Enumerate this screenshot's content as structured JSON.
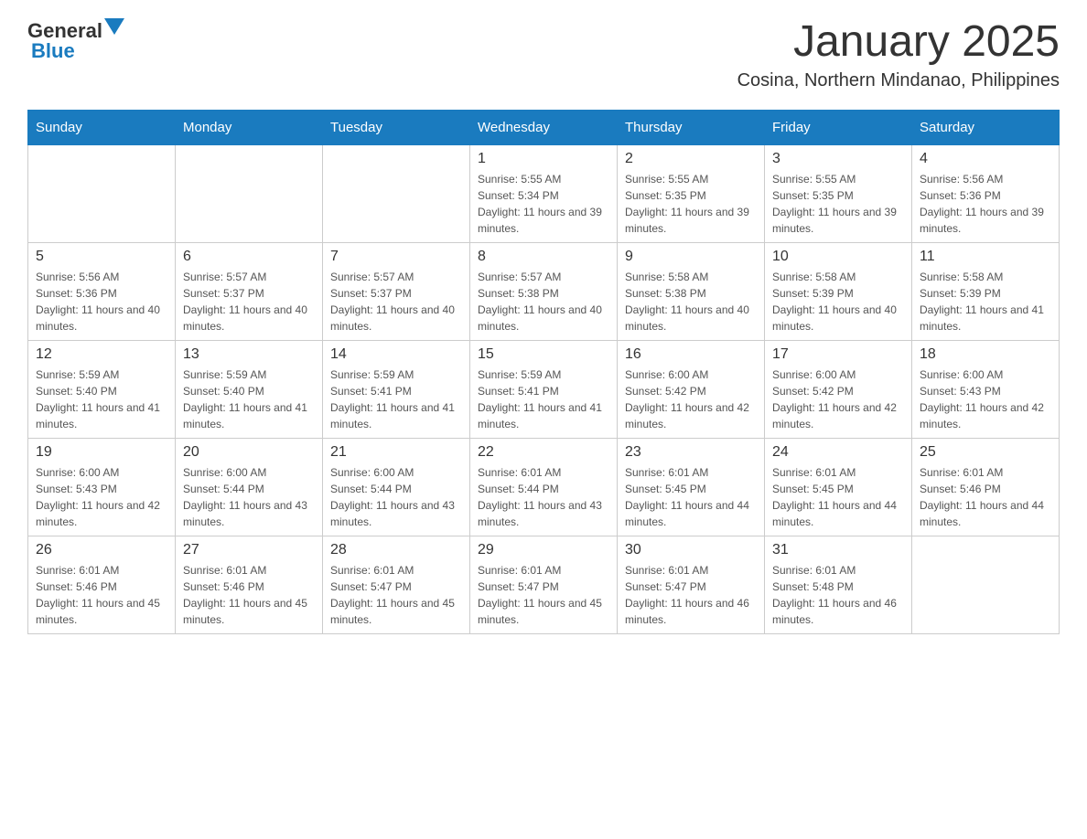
{
  "header": {
    "logo": {
      "general": "General",
      "blue": "Blue"
    },
    "title": "January 2025",
    "location": "Cosina, Northern Mindanao, Philippines"
  },
  "weekdays": [
    "Sunday",
    "Monday",
    "Tuesday",
    "Wednesday",
    "Thursday",
    "Friday",
    "Saturday"
  ],
  "weeks": [
    [
      {
        "day": "",
        "info": ""
      },
      {
        "day": "",
        "info": ""
      },
      {
        "day": "",
        "info": ""
      },
      {
        "day": "1",
        "info": "Sunrise: 5:55 AM\nSunset: 5:34 PM\nDaylight: 11 hours and 39 minutes."
      },
      {
        "day": "2",
        "info": "Sunrise: 5:55 AM\nSunset: 5:35 PM\nDaylight: 11 hours and 39 minutes."
      },
      {
        "day": "3",
        "info": "Sunrise: 5:55 AM\nSunset: 5:35 PM\nDaylight: 11 hours and 39 minutes."
      },
      {
        "day": "4",
        "info": "Sunrise: 5:56 AM\nSunset: 5:36 PM\nDaylight: 11 hours and 39 minutes."
      }
    ],
    [
      {
        "day": "5",
        "info": "Sunrise: 5:56 AM\nSunset: 5:36 PM\nDaylight: 11 hours and 40 minutes."
      },
      {
        "day": "6",
        "info": "Sunrise: 5:57 AM\nSunset: 5:37 PM\nDaylight: 11 hours and 40 minutes."
      },
      {
        "day": "7",
        "info": "Sunrise: 5:57 AM\nSunset: 5:37 PM\nDaylight: 11 hours and 40 minutes."
      },
      {
        "day": "8",
        "info": "Sunrise: 5:57 AM\nSunset: 5:38 PM\nDaylight: 11 hours and 40 minutes."
      },
      {
        "day": "9",
        "info": "Sunrise: 5:58 AM\nSunset: 5:38 PM\nDaylight: 11 hours and 40 minutes."
      },
      {
        "day": "10",
        "info": "Sunrise: 5:58 AM\nSunset: 5:39 PM\nDaylight: 11 hours and 40 minutes."
      },
      {
        "day": "11",
        "info": "Sunrise: 5:58 AM\nSunset: 5:39 PM\nDaylight: 11 hours and 41 minutes."
      }
    ],
    [
      {
        "day": "12",
        "info": "Sunrise: 5:59 AM\nSunset: 5:40 PM\nDaylight: 11 hours and 41 minutes."
      },
      {
        "day": "13",
        "info": "Sunrise: 5:59 AM\nSunset: 5:40 PM\nDaylight: 11 hours and 41 minutes."
      },
      {
        "day": "14",
        "info": "Sunrise: 5:59 AM\nSunset: 5:41 PM\nDaylight: 11 hours and 41 minutes."
      },
      {
        "day": "15",
        "info": "Sunrise: 5:59 AM\nSunset: 5:41 PM\nDaylight: 11 hours and 41 minutes."
      },
      {
        "day": "16",
        "info": "Sunrise: 6:00 AM\nSunset: 5:42 PM\nDaylight: 11 hours and 42 minutes."
      },
      {
        "day": "17",
        "info": "Sunrise: 6:00 AM\nSunset: 5:42 PM\nDaylight: 11 hours and 42 minutes."
      },
      {
        "day": "18",
        "info": "Sunrise: 6:00 AM\nSunset: 5:43 PM\nDaylight: 11 hours and 42 minutes."
      }
    ],
    [
      {
        "day": "19",
        "info": "Sunrise: 6:00 AM\nSunset: 5:43 PM\nDaylight: 11 hours and 42 minutes."
      },
      {
        "day": "20",
        "info": "Sunrise: 6:00 AM\nSunset: 5:44 PM\nDaylight: 11 hours and 43 minutes."
      },
      {
        "day": "21",
        "info": "Sunrise: 6:00 AM\nSunset: 5:44 PM\nDaylight: 11 hours and 43 minutes."
      },
      {
        "day": "22",
        "info": "Sunrise: 6:01 AM\nSunset: 5:44 PM\nDaylight: 11 hours and 43 minutes."
      },
      {
        "day": "23",
        "info": "Sunrise: 6:01 AM\nSunset: 5:45 PM\nDaylight: 11 hours and 44 minutes."
      },
      {
        "day": "24",
        "info": "Sunrise: 6:01 AM\nSunset: 5:45 PM\nDaylight: 11 hours and 44 minutes."
      },
      {
        "day": "25",
        "info": "Sunrise: 6:01 AM\nSunset: 5:46 PM\nDaylight: 11 hours and 44 minutes."
      }
    ],
    [
      {
        "day": "26",
        "info": "Sunrise: 6:01 AM\nSunset: 5:46 PM\nDaylight: 11 hours and 45 minutes."
      },
      {
        "day": "27",
        "info": "Sunrise: 6:01 AM\nSunset: 5:46 PM\nDaylight: 11 hours and 45 minutes."
      },
      {
        "day": "28",
        "info": "Sunrise: 6:01 AM\nSunset: 5:47 PM\nDaylight: 11 hours and 45 minutes."
      },
      {
        "day": "29",
        "info": "Sunrise: 6:01 AM\nSunset: 5:47 PM\nDaylight: 11 hours and 45 minutes."
      },
      {
        "day": "30",
        "info": "Sunrise: 6:01 AM\nSunset: 5:47 PM\nDaylight: 11 hours and 46 minutes."
      },
      {
        "day": "31",
        "info": "Sunrise: 6:01 AM\nSunset: 5:48 PM\nDaylight: 11 hours and 46 minutes."
      },
      {
        "day": "",
        "info": ""
      }
    ]
  ]
}
